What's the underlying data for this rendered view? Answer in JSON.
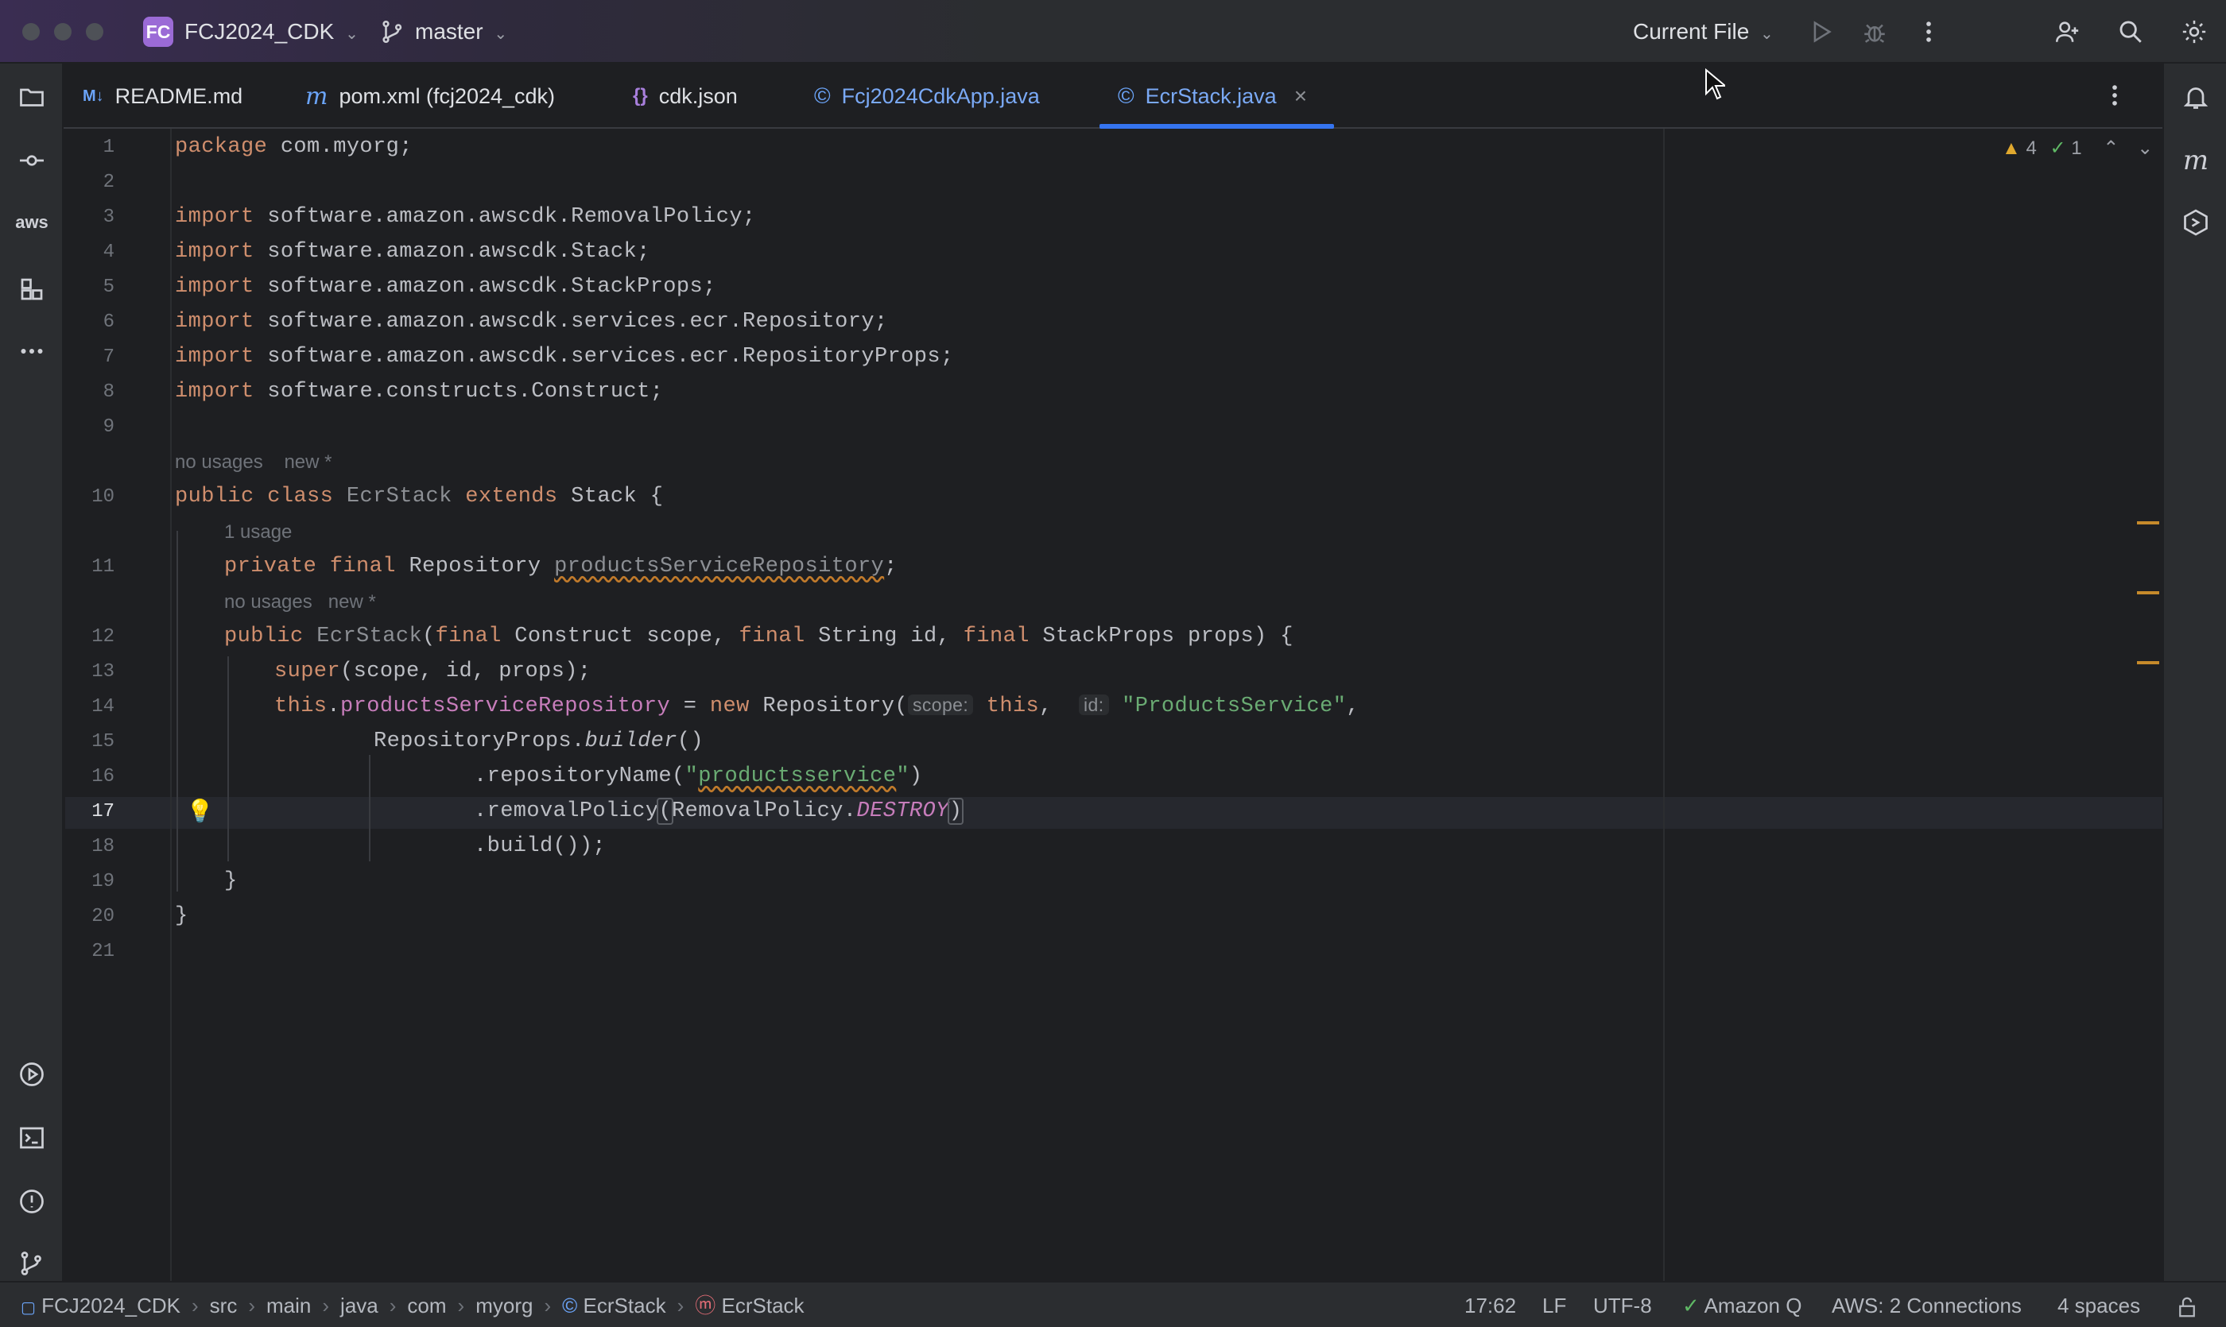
{
  "titlebar": {
    "project_badge": "FC",
    "project_name": "FCJ2024_CDK",
    "branch": "master",
    "run_config": "Current File"
  },
  "tabs": [
    {
      "icon": "M↓",
      "label": "README.md"
    },
    {
      "icon": "m",
      "label": "pom.xml (fcj2024_cdk)"
    },
    {
      "icon": "{}",
      "label": "cdk.json"
    },
    {
      "icon": "©",
      "label": "Fcj2024CdkApp.java"
    },
    {
      "icon": "©",
      "label": "EcrStack.java",
      "active": true,
      "close": "×"
    }
  ],
  "editor": {
    "inspections": {
      "warnings": "4",
      "ok": "1"
    },
    "line_numbers": [
      "1",
      "2",
      "3",
      "4",
      "5",
      "6",
      "7",
      "8",
      "9",
      "10",
      "11",
      "12",
      "13",
      "14",
      "15",
      "16",
      "17",
      "18",
      "19",
      "20",
      "21"
    ],
    "current_line": "17",
    "hints": {
      "class_usages": "no usages",
      "class_new": "new *",
      "field_usages": "1 usage",
      "ctor_usages": "no usages",
      "ctor_new": "new *"
    },
    "code": {
      "l1_kw": "package",
      "l1_rest": " com.myorg;",
      "import_kw": "import",
      "l3": " software.amazon.awscdk.RemovalPolicy;",
      "l4": " software.amazon.awscdk.Stack;",
      "l5": " software.amazon.awscdk.StackProps;",
      "l6": " software.amazon.awscdk.services.ecr.Repository;",
      "l7": " software.amazon.awscdk.services.ecr.RepositoryProps;",
      "l8": " software.constructs.Construct;",
      "l10_public": "public",
      "l10_class": "class",
      "l10_name": "EcrStack",
      "l10_extends": "extends",
      "l10_rest": " Stack {",
      "l11_private": "private",
      "l11_final": "final",
      "l11_type": " Repository ",
      "l11_field": "productsServiceRepository",
      "l11_end": ";",
      "l12_public": "public",
      "l12_name": "EcrStack",
      "l12_a": "(",
      "l12_final1": "final",
      "l12_b": " Construct scope, ",
      "l12_final2": "final",
      "l12_c": " String id, ",
      "l12_final3": "final",
      "l12_d": " StackProps props) {",
      "l13_super": "super",
      "l13_rest": "(scope, id, props);",
      "l14_this": "this",
      "l14_dot": ".",
      "l14_field": "productsServiceRepository",
      "l14_eq": " = ",
      "l14_new": "new",
      "l14_repo": " Repository(",
      "l14_hint_scope": "scope:",
      "l14_this2": "this",
      "l14_comma": ", ",
      "l14_hint_id": "id:",
      "l14_str": "\"ProductsService\"",
      "l14_end": ",",
      "l15_a": "RepositoryProps.",
      "l15_builder": "builder",
      "l15_b": "()",
      "l16_a": ".repositoryName(",
      "l16_str_q1": "\"",
      "l16_str": "productsservice",
      "l16_str_q2": "\"",
      "l16_b": ")",
      "l17_a": ".removalPolicy",
      "l17_paren_open": "(",
      "l17_b": "RemovalPolicy.",
      "l17_const": "DESTROY",
      "l17_paren_close": ")",
      "l18": ".build());",
      "l19": "}",
      "l20": "}"
    }
  },
  "statusbar": {
    "breadcrumbs": [
      "FCJ2024_CDK",
      "src",
      "main",
      "java",
      "com",
      "myorg",
      "EcrStack",
      "EcrStack"
    ],
    "position": "17:62",
    "line_sep": "LF",
    "encoding": "UTF-8",
    "amazon_q": "Amazon Q",
    "aws": "AWS: 2 Connections",
    "indent": "4 spaces"
  },
  "colors": {
    "keyword": "#cf8e6d",
    "string": "#6aab73",
    "field": "#c77dbb",
    "accent": "#3574f0",
    "project_badge": "#9b6bd6",
    "warning": "#e0a82e"
  }
}
